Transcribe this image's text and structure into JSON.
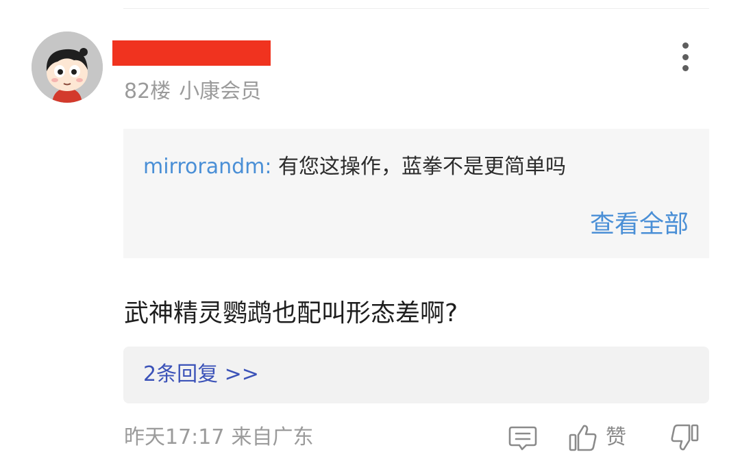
{
  "comment": {
    "floor": "82楼",
    "member_level": "小康会员",
    "quote": {
      "username": "mirrorandm:",
      "text": "有您这操作，蓝拳不是更简单吗",
      "view_all_label": "查看全部"
    },
    "text": "武神精灵鹦鹉也配叫形态差啊?",
    "replies_label": "2条回复 >>",
    "timestamp": "昨天17:17",
    "location": "来自广东",
    "like_label": "赞"
  },
  "icons": {
    "more": "more-vertical-icon",
    "reply": "comment-icon",
    "like": "thumbs-up-icon",
    "dislike": "thumbs-down-icon"
  },
  "colors": {
    "link_blue": "#4a8fd6",
    "reply_link": "#3b52b8",
    "meta_gray": "#9b9b9b",
    "redaction": "#f0331f"
  }
}
